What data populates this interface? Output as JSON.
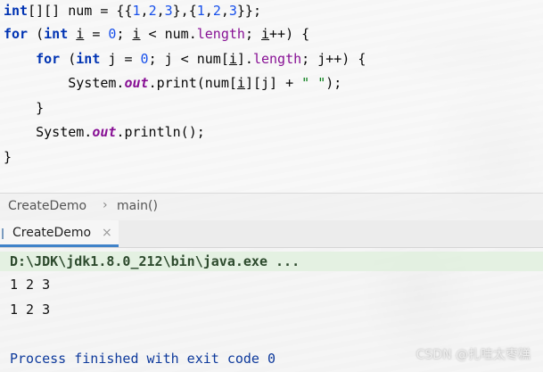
{
  "editor": {
    "lines": [
      {
        "parts": [
          {
            "t": "int",
            "c": "kw"
          },
          {
            "t": "[][] num = {{",
            "c": ""
          },
          {
            "t": "1",
            "c": "num"
          },
          {
            "t": ",",
            "c": ""
          },
          {
            "t": "2",
            "c": "num"
          },
          {
            "t": ",",
            "c": ""
          },
          {
            "t": "3",
            "c": "num"
          },
          {
            "t": "},{",
            "c": ""
          },
          {
            "t": "1",
            "c": "num"
          },
          {
            "t": ",",
            "c": ""
          },
          {
            "t": "2",
            "c": "num"
          },
          {
            "t": ",",
            "c": ""
          },
          {
            "t": "3",
            "c": "num"
          },
          {
            "t": "}};",
            "c": ""
          }
        ]
      },
      {
        "parts": [
          {
            "t": "for",
            "c": "kw"
          },
          {
            "t": " (",
            "c": ""
          },
          {
            "t": "int",
            "c": "kw"
          },
          {
            "t": " ",
            "c": ""
          },
          {
            "t": "i",
            "c": "ul"
          },
          {
            "t": " = ",
            "c": ""
          },
          {
            "t": "0",
            "c": "num"
          },
          {
            "t": "; ",
            "c": ""
          },
          {
            "t": "i",
            "c": "ul"
          },
          {
            "t": " < num.",
            "c": ""
          },
          {
            "t": "length",
            "c": "fld"
          },
          {
            "t": "; ",
            "c": ""
          },
          {
            "t": "i",
            "c": "ul"
          },
          {
            "t": "++) {",
            "c": ""
          }
        ]
      },
      {
        "parts": [
          {
            "t": "    ",
            "c": ""
          },
          {
            "t": "for",
            "c": "kw"
          },
          {
            "t": " (",
            "c": ""
          },
          {
            "t": "int",
            "c": "kw"
          },
          {
            "t": " j = ",
            "c": ""
          },
          {
            "t": "0",
            "c": "num"
          },
          {
            "t": "; j < num[",
            "c": ""
          },
          {
            "t": "i",
            "c": "ul"
          },
          {
            "t": "].",
            "c": ""
          },
          {
            "t": "length",
            "c": "fld"
          },
          {
            "t": "; j++) {",
            "c": ""
          }
        ]
      },
      {
        "parts": [
          {
            "t": "        System.",
            "c": ""
          },
          {
            "t": "out",
            "c": "italic-fld"
          },
          {
            "t": ".print(num[",
            "c": ""
          },
          {
            "t": "i",
            "c": "ul"
          },
          {
            "t": "][j] + ",
            "c": ""
          },
          {
            "t": "\" \"",
            "c": "str"
          },
          {
            "t": ");",
            "c": ""
          }
        ]
      },
      {
        "parts": [
          {
            "t": "    }",
            "c": ""
          }
        ]
      },
      {
        "parts": [
          {
            "t": "    System.",
            "c": ""
          },
          {
            "t": "out",
            "c": "italic-fld"
          },
          {
            "t": ".println();",
            "c": ""
          }
        ]
      },
      {
        "parts": [
          {
            "t": "}",
            "c": ""
          }
        ]
      }
    ]
  },
  "breadcrumb": {
    "class_name": "CreateDemo",
    "separator": "›",
    "method_name": "main()"
  },
  "run_panel": {
    "tab_label": "CreateDemo",
    "close_glyph": "×"
  },
  "console": {
    "command": "D:\\JDK\\jdk1.8.0_212\\bin\\java.exe ...",
    "output_lines": [
      "1 2 3",
      "1 2 3"
    ],
    "exit_message": "Process finished with exit code 0"
  },
  "watermark": "CSDN @扎哇太枣糕"
}
